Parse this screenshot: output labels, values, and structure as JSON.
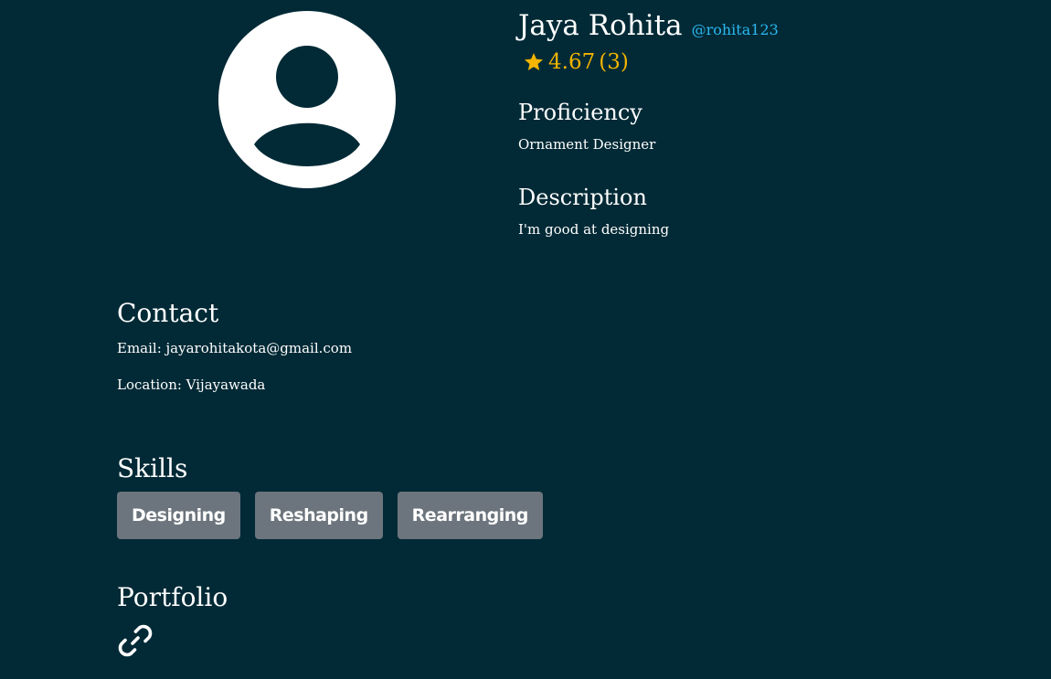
{
  "profile": {
    "name": "Jaya Rohita",
    "handle": "@rohita123",
    "rating": "4.67",
    "rating_count": "(3)",
    "avatar_icon": "user-avatar-icon"
  },
  "proficiency": {
    "title": "Proficiency",
    "value": "Ornament Designer"
  },
  "description": {
    "title": "Description",
    "value": "I'm good at designing"
  },
  "contact": {
    "title": "Contact",
    "email": "Email: jayarohitakota@gmail.com",
    "location": "Location: Vijayawada"
  },
  "skills": {
    "title": "Skills",
    "items": [
      "Designing",
      "Reshaping",
      "Rearranging"
    ]
  },
  "portfolio": {
    "title": "Portfolio",
    "icon": "link-icon"
  },
  "colors": {
    "background": "#012a36",
    "accent_handle": "#2bb7f0",
    "rating": "#f4b400",
    "chip": "#6c757d"
  }
}
